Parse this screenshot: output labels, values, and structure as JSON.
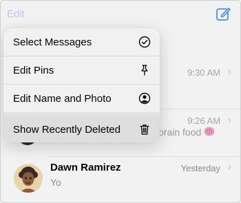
{
  "topbar": {
    "edit_label": "Edit",
    "compose_icon": "compose-icon"
  },
  "menu": {
    "items": [
      {
        "label": "Select Messages",
        "icon": "checkmark-circle-icon"
      },
      {
        "label": "Edit Pins",
        "icon": "pin-icon"
      },
      {
        "label": "Edit Name and Photo",
        "icon": "person-circle-icon"
      },
      {
        "label": "Show Recently Deleted",
        "icon": "trash-icon",
        "highlighted": true
      }
    ]
  },
  "conversations": [
    {
      "time": "9:30 AM"
    },
    {
      "time": "9:26 AM",
      "preview_fragment": "orain food"
    },
    {
      "name": "Dawn Ramirez",
      "preview": "Yo",
      "time": "Yesterday"
    }
  ],
  "colors": {
    "accent": "#0a84ff",
    "dimmed_accent": "#b7c9e8",
    "secondary_text": "#8a8a8e"
  }
}
